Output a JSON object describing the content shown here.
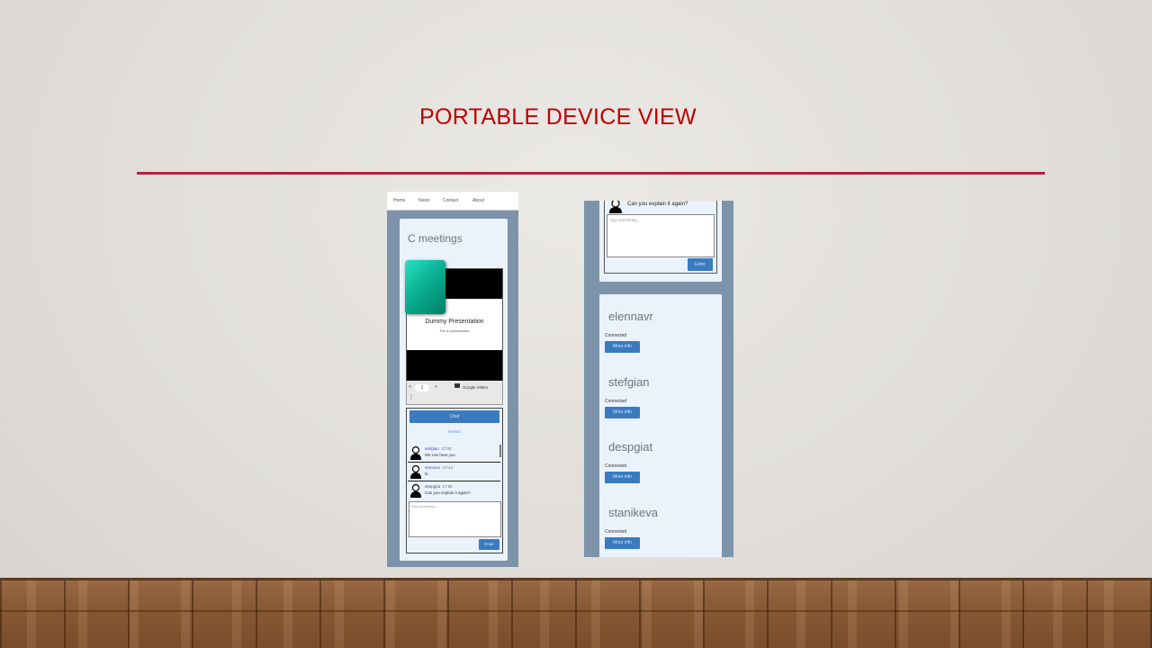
{
  "slide": {
    "title": "PORTABLE DEVICE VIEW"
  },
  "phone1": {
    "nav": [
      "Home",
      "News",
      "Contact",
      "About"
    ],
    "app_title": "C meetings",
    "presentation": {
      "title": "Dummy Presentation",
      "subtitle": "This is a presentation",
      "page": "1",
      "prev": "<",
      "next": ">",
      "google_slides": "Google Slides"
    },
    "chat_button": "Chat",
    "events_label": "Events",
    "messages": [
      {
        "user": "stefgian",
        "time": "17:00",
        "text": "We can hear you"
      },
      {
        "user": "elennavr",
        "time": "17:14",
        "text": "hi"
      },
      {
        "user": "despgiat",
        "time": "17:55",
        "text": "Can you explain it again?"
      }
    ],
    "input_placeholder": "Say something...",
    "enter_button": "Enter"
  },
  "phone2": {
    "last_message": "Can you explain it again?",
    "input_placeholder": "Say something...",
    "enter_button": "Enter",
    "users": [
      {
        "name": "elennavr",
        "status": "Connected",
        "button": "More info"
      },
      {
        "name": "stefgian",
        "status": "Connected",
        "button": "More info"
      },
      {
        "name": "despgiat",
        "status": "Connected",
        "button": "More info"
      },
      {
        "name": "stanikeva",
        "status": "Connected",
        "button": "More info"
      }
    ]
  }
}
